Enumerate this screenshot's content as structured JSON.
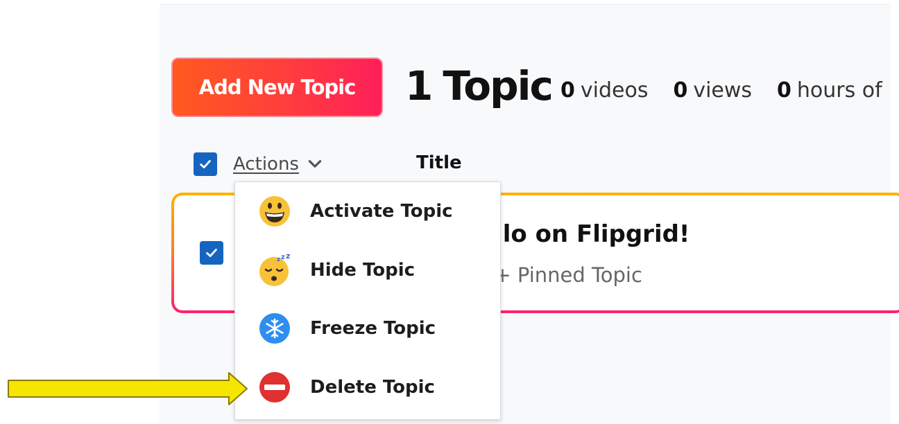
{
  "toolbar": {
    "add_button_label": "Add New Topic"
  },
  "summary": {
    "count_number": "1",
    "count_label": "Topic",
    "stats": [
      {
        "value": "0",
        "label": "videos"
      },
      {
        "value": "0",
        "label": "views"
      },
      {
        "value": "0",
        "label": "hours of"
      }
    ]
  },
  "table_header": {
    "actions_label": "Actions",
    "title_label": "Title"
  },
  "topic_card": {
    "title": "ello on Flipgrid!",
    "subtitle": "s + Pinned Topic"
  },
  "actions_menu": {
    "items": [
      {
        "label": "Activate Topic",
        "icon": "grinning-face-icon"
      },
      {
        "label": "Hide Topic",
        "icon": "sleeping-face-icon"
      },
      {
        "label": "Freeze Topic",
        "icon": "snowflake-icon"
      },
      {
        "label": "Delete Topic",
        "icon": "no-entry-icon"
      }
    ]
  },
  "colors": {
    "brand_gradient_start": "#ff5a1f",
    "brand_gradient_end": "#ff1f5a",
    "checkbox_blue": "#1565c0",
    "annotation_arrow": "#f5e500"
  }
}
